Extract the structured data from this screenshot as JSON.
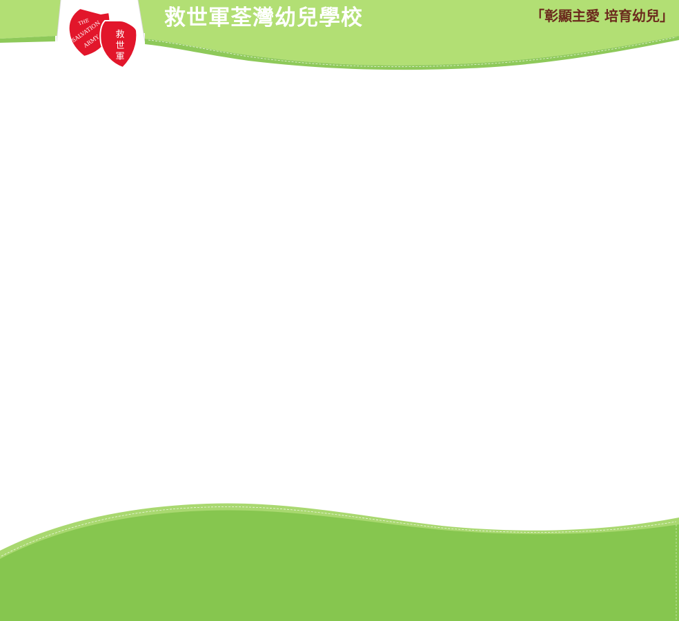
{
  "header": {
    "school_name": "救世軍荃灣幼兒學校",
    "motto": "「彰顯主愛 培育幼兒」"
  },
  "logo": {
    "text_line1": "THE",
    "text_line2": "SALVATION",
    "text_line3": "ARMY",
    "chinese_text": "救世軍",
    "icon": "salvation-army-shield-logo"
  },
  "colors": {
    "header_green": "#b2df74",
    "header_dark_band": "#8ec95a",
    "footer_green": "#86c64f",
    "footer_light_band": "#a9d870",
    "logo_red": "#e2162b",
    "motto_brown": "#6b2a1d"
  }
}
